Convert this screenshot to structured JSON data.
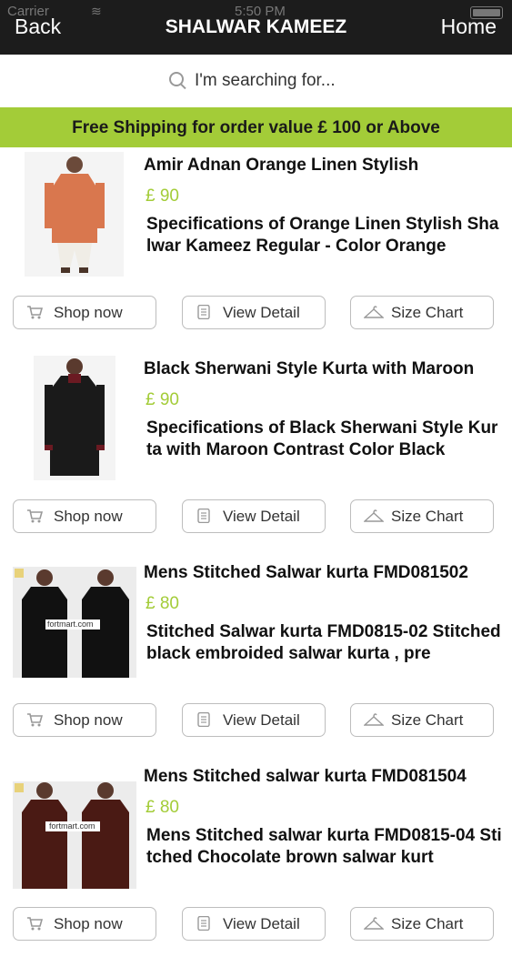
{
  "status_bar": {
    "carrier": "Carrier",
    "time": "5:50 PM"
  },
  "nav": {
    "back": "Back",
    "title": "SHALWAR KAMEEZ",
    "home": "Home"
  },
  "search": {
    "placeholder": "I'm searching for..."
  },
  "banner": {
    "text": "Free Shipping for order value £ 100 or Above"
  },
  "buttons": {
    "shop": "Shop now",
    "view": "View Detail",
    "size": "Size Chart"
  },
  "products": [
    {
      "title": "Amir Adnan Orange Linen Stylish",
      "price": "£ 90",
      "description": "Specifications of Orange Linen Stylish Shalwar Kameez Regular -    Color Orange"
    },
    {
      "title": "Black Sherwani Style Kurta with Maroon",
      "price": "£ 90",
      "description": "Specifications of Black Sherwani Style Kurta with Maroon Contrast    Color Black"
    },
    {
      "title": "Mens Stitched  Salwar kurta FMD081502",
      "price": "£ 80",
      "description": "Stitched Salwar kurta FMD0815-02    Stitched black embroided salwar kurta , pre",
      "watermark": "fortmart.com"
    },
    {
      "title": "Mens Stitched salwar kurta FMD081504",
      "price": "£ 80",
      "description": "Mens Stitched salwar kurta FMD0815-04 Stitched Chocolate brown salwar kurt",
      "watermark": "fortmart.com"
    }
  ],
  "colors": {
    "accent": "#a3cc38",
    "navbar": "#1c1c1c"
  }
}
